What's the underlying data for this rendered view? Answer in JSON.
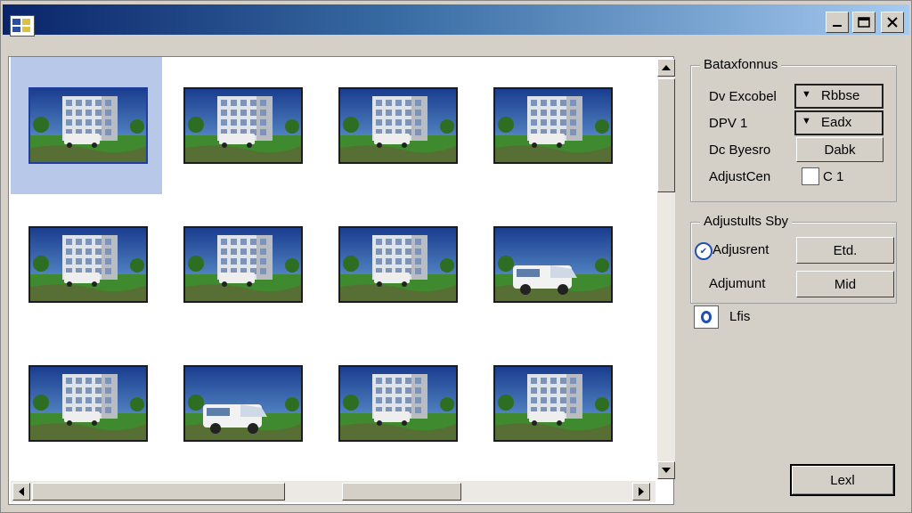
{
  "window": {
    "title": "",
    "controls": [
      "minimize",
      "maximize",
      "close"
    ]
  },
  "thumbnails": [
    {
      "subject": "building",
      "selected": true
    },
    {
      "subject": "building",
      "selected": false
    },
    {
      "subject": "building",
      "selected": false
    },
    {
      "subject": "building",
      "selected": false
    },
    {
      "subject": "building",
      "selected": false
    },
    {
      "subject": "building",
      "selected": false
    },
    {
      "subject": "building",
      "selected": false
    },
    {
      "subject": "van",
      "selected": false
    },
    {
      "subject": "building",
      "selected": false
    },
    {
      "subject": "van",
      "selected": false
    },
    {
      "subject": "building",
      "selected": false
    },
    {
      "subject": "building",
      "selected": false
    }
  ],
  "group1": {
    "legend": "Bataxfonnus",
    "rows": [
      {
        "label": "Dv Excobel",
        "control": "dropdown",
        "value": "Rbbse"
      },
      {
        "label": "DPV 1",
        "control": "dropdown",
        "value": "Eadx"
      },
      {
        "label": "Dc Byesro",
        "control": "button",
        "value": "Dabk"
      },
      {
        "label": "AdjustCen",
        "control": "checkbox",
        "value": "C 1"
      }
    ]
  },
  "group2": {
    "legend": "Adjustults Sby",
    "rows": [
      {
        "label": "Adjusrent",
        "radio": true,
        "button": "Etd."
      },
      {
        "label": "Adjumunt",
        "radio": false,
        "button": "Mid"
      }
    ]
  },
  "list_option": {
    "label": "Lfis"
  },
  "footer": {
    "primary_button": "Lexl"
  },
  "colors": {
    "titlebar_start": "#0a246a",
    "titlebar_end": "#a6caf0",
    "selection": "#b7c8e8",
    "face": "#d4d0c8"
  }
}
